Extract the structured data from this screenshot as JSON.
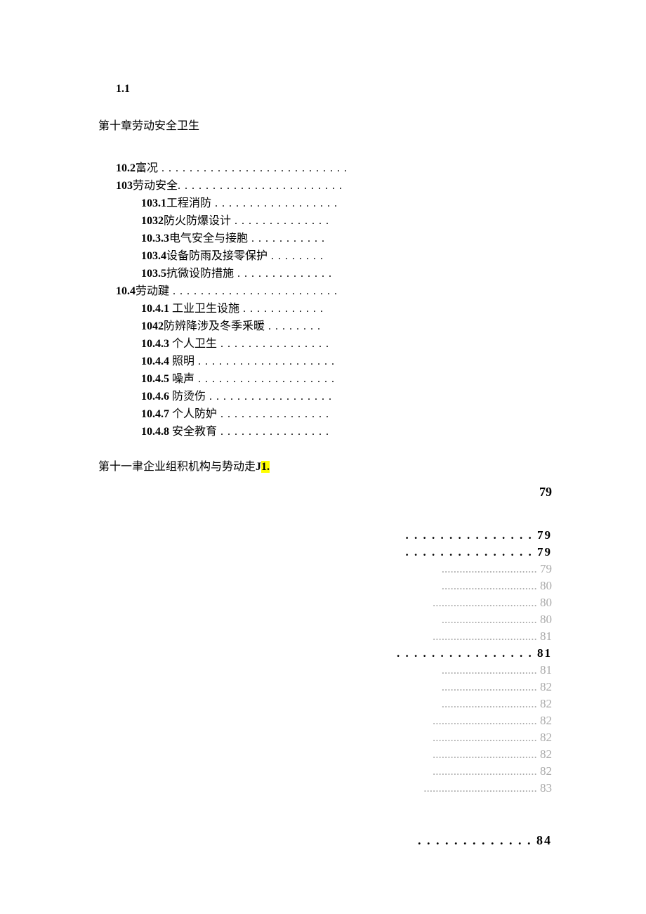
{
  "header_num": "1.1",
  "chapter10_title": "第十章劳动安全卫生",
  "toc": [
    {
      "num": "10.2",
      "label": "富况",
      "dots": " . . . . . . . . . . . . . . . . . . . . . . . . . . .",
      "indent": false
    },
    {
      "num": "103",
      "label": "劳动安全",
      "dots": ". . . . . . . . . . . . . . . . . . . . . . . .",
      "indent": false
    },
    {
      "num": "103.1",
      "label": "工程消防",
      "dots": " . . . . . . . . . . . . . . . . . .",
      "indent": true
    },
    {
      "num": "1032",
      "label": "防火防爆设计",
      "dots": "  . . . . . . . . . . . . . .",
      "indent": true
    },
    {
      "num": "10.3.3",
      "label": "电气安全与接胞",
      "dots": "  . . . . . . . . . . .",
      "indent": true
    },
    {
      "num": "103.4",
      "label": "设备防雨及接零保护",
      "dots": " . . . . . . . .",
      "indent": true
    },
    {
      "num": "103.5",
      "label": "抗微设防措施",
      "dots": " . . . . . . . . . . . . . .",
      "indent": true
    },
    {
      "num": "10.4",
      "label": "劳动踺",
      "dots": " . . . . . . . . . . . . . . . . . . . . . . . .",
      "indent": false
    },
    {
      "num": "10.4.1",
      "label": "  工业卫生设施",
      "dots": "  . . . . . . . . . . . .",
      "indent": true
    },
    {
      "num": "1042",
      "label": "防辨降涉及冬季釆暖",
      "dots": "  . . . . . . . .",
      "indent": true
    },
    {
      "num": "10.4.3",
      "label": "  个人卫生",
      "dots": " . . . . . . . . . . . . . . . .",
      "indent": true
    },
    {
      "num": "10.4.4",
      "label": "  照明",
      "dots": " . . . . . . . . . . . . . . . . . . . .",
      "indent": true
    },
    {
      "num": "10.4.5",
      "label": "  噪声",
      "dots": " . . . . . . . . . . . . . . . . . . . .",
      "indent": true
    },
    {
      "num": "10.4.6",
      "label": "  防烫伤",
      "dots": " . . . . . . . . . . . . . . . . . .",
      "indent": true
    },
    {
      "num": "10.4.7",
      "label": "  个人防妒",
      "dots": " . . . . . . . . . . . . . . . .",
      "indent": true
    },
    {
      "num": "10.4.8",
      "label": "  安全教育",
      "dots": "  . . . . . . . . . . . . . . . .",
      "indent": true
    }
  ],
  "chapter11_prefix": "第十一聿企业组积机构与势动走",
  "chapter11_j": "J",
  "chapter11_hl": "1.",
  "page_head": "79",
  "pages": [
    {
      "dots": ". . . . . . . . . . . . . . .",
      "pg": " 79",
      "style": "bold"
    },
    {
      "dots": ". . . . . . . . . . . . . . .",
      "pg": " 79",
      "style": "bold"
    },
    {
      "dots": "................................",
      "pg": " 79",
      "style": "faint"
    },
    {
      "dots": "................................",
      "pg": " 80",
      "style": "faint"
    },
    {
      "dots": "...................................",
      "pg": " 80",
      "style": "faint"
    },
    {
      "dots": "................................",
      "pg": " 80",
      "style": "faint"
    },
    {
      "dots": "...................................",
      "pg": " 81",
      "style": "faint"
    },
    {
      "dots": ". . . . . . . . . . . . . . . .",
      "pg": " 81",
      "style": "bold"
    },
    {
      "dots": "................................",
      "pg": " 81",
      "style": "faint"
    },
    {
      "dots": "................................",
      "pg": " 82",
      "style": "faint"
    },
    {
      "dots": "................................",
      "pg": " 82",
      "style": "faint"
    },
    {
      "dots": "...................................",
      "pg": " 82",
      "style": "faint"
    },
    {
      "dots": "...................................",
      "pg": " 82",
      "style": "faint"
    },
    {
      "dots": "...................................",
      "pg": " 82",
      "style": "faint"
    },
    {
      "dots": "...................................",
      "pg": " 82",
      "style": "faint"
    },
    {
      "dots": "......................................",
      "pg": " 83",
      "style": "faint"
    }
  ],
  "final_dots": ". . . . . . . . . . . . .",
  "final_pg": " 84"
}
